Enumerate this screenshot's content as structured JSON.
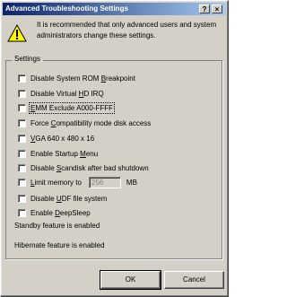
{
  "window": {
    "title": "Advanced Troubleshooting Settings"
  },
  "titlebar": {
    "help_label": "?",
    "close_label": "×"
  },
  "message": "It is recommended that only advanced users and system administrators change these settings.",
  "settings": {
    "group_label": "Settings",
    "options": [
      {
        "pre": "Disable System ROM ",
        "key": "B",
        "post": "reakpoint",
        "checked": false
      },
      {
        "pre": "Disable Virtual ",
        "key": "H",
        "post": "D IRQ",
        "checked": false
      },
      {
        "pre": "",
        "key": "E",
        "post": "MM Exclude A000-FFFF",
        "checked": false
      },
      {
        "pre": "Force ",
        "key": "C",
        "post": "ompatibility mode disk access",
        "checked": false
      },
      {
        "pre": "",
        "key": "V",
        "post": "GA 640 x 480 x 16",
        "checked": false
      },
      {
        "pre": "Enable Startup ",
        "key": "M",
        "post": "enu",
        "checked": false
      },
      {
        "pre": "Disable ",
        "key": "S",
        "post": "candisk after bad shutdown",
        "checked": false
      },
      {
        "pre": "",
        "key": "L",
        "post": "imit memory to",
        "checked": false
      },
      {
        "pre": "Disable ",
        "key": "U",
        "post": "DF file system",
        "checked": false
      },
      {
        "pre": "Enable ",
        "key": "D",
        "post": "eepSleep",
        "checked": false
      }
    ],
    "memory_value": "256",
    "memory_unit": "MB",
    "standby_text": "Standby feature is enabled",
    "hibernate_text": "Hibernate feature is enabled"
  },
  "buttons": {
    "ok": "OK",
    "cancel": "Cancel"
  }
}
